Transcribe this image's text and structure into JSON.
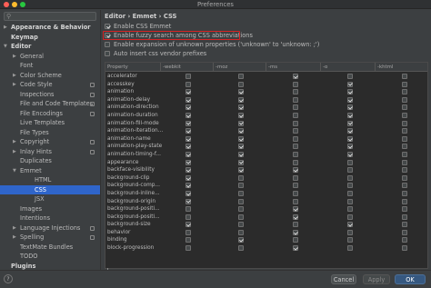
{
  "window": {
    "title": "Preferences"
  },
  "sidebar": {
    "items": [
      {
        "label": "Appearance & Behavior",
        "indent": 0,
        "chevron": "right",
        "bold": true,
        "copy": false,
        "selected": false
      },
      {
        "label": "Keymap",
        "indent": 0,
        "chevron": "",
        "bold": true,
        "copy": false,
        "selected": false
      },
      {
        "label": "Editor",
        "indent": 0,
        "chevron": "down",
        "bold": true,
        "copy": false,
        "selected": false
      },
      {
        "label": "General",
        "indent": 1,
        "chevron": "right",
        "bold": false,
        "copy": false,
        "selected": false
      },
      {
        "label": "Font",
        "indent": 1,
        "chevron": "",
        "bold": false,
        "copy": false,
        "selected": false
      },
      {
        "label": "Color Scheme",
        "indent": 1,
        "chevron": "right",
        "bold": false,
        "copy": false,
        "selected": false
      },
      {
        "label": "Code Style",
        "indent": 1,
        "chevron": "right",
        "bold": false,
        "copy": true,
        "selected": false
      },
      {
        "label": "Inspections",
        "indent": 1,
        "chevron": "",
        "bold": false,
        "copy": true,
        "selected": false
      },
      {
        "label": "File and Code Templates",
        "indent": 1,
        "chevron": "",
        "bold": false,
        "copy": true,
        "selected": false
      },
      {
        "label": "File Encodings",
        "indent": 1,
        "chevron": "",
        "bold": false,
        "copy": true,
        "selected": false
      },
      {
        "label": "Live Templates",
        "indent": 1,
        "chevron": "",
        "bold": false,
        "copy": false,
        "selected": false
      },
      {
        "label": "File Types",
        "indent": 1,
        "chevron": "",
        "bold": false,
        "copy": false,
        "selected": false
      },
      {
        "label": "Copyright",
        "indent": 1,
        "chevron": "right",
        "bold": false,
        "copy": true,
        "selected": false
      },
      {
        "label": "Inlay Hints",
        "indent": 1,
        "chevron": "right",
        "bold": false,
        "copy": true,
        "selected": false
      },
      {
        "label": "Duplicates",
        "indent": 1,
        "chevron": "",
        "bold": false,
        "copy": false,
        "selected": false
      },
      {
        "label": "Emmet",
        "indent": 1,
        "chevron": "down",
        "bold": false,
        "copy": false,
        "selected": false
      },
      {
        "label": "HTML",
        "indent": 2,
        "chevron": "",
        "bold": false,
        "copy": false,
        "selected": false
      },
      {
        "label": "CSS",
        "indent": 2,
        "chevron": "",
        "bold": false,
        "copy": false,
        "selected": true
      },
      {
        "label": "JSX",
        "indent": 2,
        "chevron": "",
        "bold": false,
        "copy": false,
        "selected": false
      },
      {
        "label": "Images",
        "indent": 1,
        "chevron": "",
        "bold": false,
        "copy": false,
        "selected": false
      },
      {
        "label": "Intentions",
        "indent": 1,
        "chevron": "",
        "bold": false,
        "copy": false,
        "selected": false
      },
      {
        "label": "Language Injections",
        "indent": 1,
        "chevron": "right",
        "bold": false,
        "copy": true,
        "selected": false
      },
      {
        "label": "Spelling",
        "indent": 1,
        "chevron": "right",
        "bold": false,
        "copy": true,
        "selected": false
      },
      {
        "label": "TextMate Bundles",
        "indent": 1,
        "chevron": "",
        "bold": false,
        "copy": false,
        "selected": false
      },
      {
        "label": "TODO",
        "indent": 1,
        "chevron": "",
        "bold": false,
        "copy": false,
        "selected": false
      },
      {
        "label": "Plugins",
        "indent": 0,
        "chevron": "",
        "bold": true,
        "copy": false,
        "selected": false
      }
    ]
  },
  "main": {
    "breadcrumb": "Editor › Emmet › CSS",
    "options": [
      {
        "label": "Enable CSS Emmet",
        "checked": true,
        "highlighted": false
      },
      {
        "label": "Enable fuzzy search among CSS abbreviations",
        "checked": true,
        "highlighted": true
      },
      {
        "label": "Enable expansion of unknown properties ('unknown' to 'unknown: ;')",
        "checked": false,
        "highlighted": false
      },
      {
        "label": "Auto insert css vendor prefixes",
        "checked": false,
        "highlighted": false
      }
    ],
    "table": {
      "columns": [
        "Property",
        "-webkit",
        "-moz",
        "-ms",
        "-o",
        "-khtml"
      ],
      "rows": [
        {
          "name": "accelerator",
          "checks": [
            false,
            false,
            true,
            false,
            false
          ]
        },
        {
          "name": "accesskey",
          "checks": [
            false,
            false,
            false,
            true,
            false
          ]
        },
        {
          "name": "animation",
          "checks": [
            true,
            true,
            false,
            true,
            false
          ]
        },
        {
          "name": "animation-delay",
          "checks": [
            true,
            true,
            false,
            true,
            false
          ]
        },
        {
          "name": "animation-direction",
          "checks": [
            true,
            true,
            false,
            true,
            false
          ]
        },
        {
          "name": "animation-duration",
          "checks": [
            true,
            true,
            false,
            true,
            false
          ]
        },
        {
          "name": "animation-fill-mode",
          "checks": [
            true,
            true,
            false,
            true,
            false
          ]
        },
        {
          "name": "animation-iteration...",
          "checks": [
            true,
            true,
            false,
            true,
            false
          ]
        },
        {
          "name": "animation-name",
          "checks": [
            true,
            true,
            false,
            true,
            false
          ]
        },
        {
          "name": "animation-play-state",
          "checks": [
            true,
            true,
            false,
            true,
            false
          ]
        },
        {
          "name": "animation-timing-f...",
          "checks": [
            true,
            true,
            false,
            true,
            false
          ]
        },
        {
          "name": "appearance",
          "checks": [
            true,
            true,
            false,
            false,
            false
          ]
        },
        {
          "name": "backface-visibility",
          "checks": [
            true,
            true,
            true,
            false,
            false
          ]
        },
        {
          "name": "background-clip",
          "checks": [
            true,
            false,
            false,
            false,
            false
          ]
        },
        {
          "name": "background-comp...",
          "checks": [
            true,
            false,
            false,
            false,
            false
          ]
        },
        {
          "name": "background-inline...",
          "checks": [
            true,
            false,
            false,
            false,
            false
          ]
        },
        {
          "name": "background-origin",
          "checks": [
            true,
            false,
            false,
            false,
            false
          ]
        },
        {
          "name": "background-positi...",
          "checks": [
            false,
            false,
            true,
            false,
            false
          ]
        },
        {
          "name": "background-positi...",
          "checks": [
            false,
            false,
            true,
            false,
            false
          ]
        },
        {
          "name": "background-size",
          "checks": [
            true,
            false,
            false,
            true,
            false
          ]
        },
        {
          "name": "behavior",
          "checks": [
            false,
            false,
            true,
            false,
            false
          ]
        },
        {
          "name": "binding",
          "checks": [
            false,
            true,
            false,
            false,
            false
          ]
        },
        {
          "name": "block-progression",
          "checks": [
            false,
            false,
            true,
            false,
            false
          ]
        }
      ]
    },
    "add_label": "+"
  },
  "footer": {
    "help_label": "?",
    "cancel_label": "Cancel",
    "apply_label": "Apply",
    "ok_label": "OK"
  }
}
